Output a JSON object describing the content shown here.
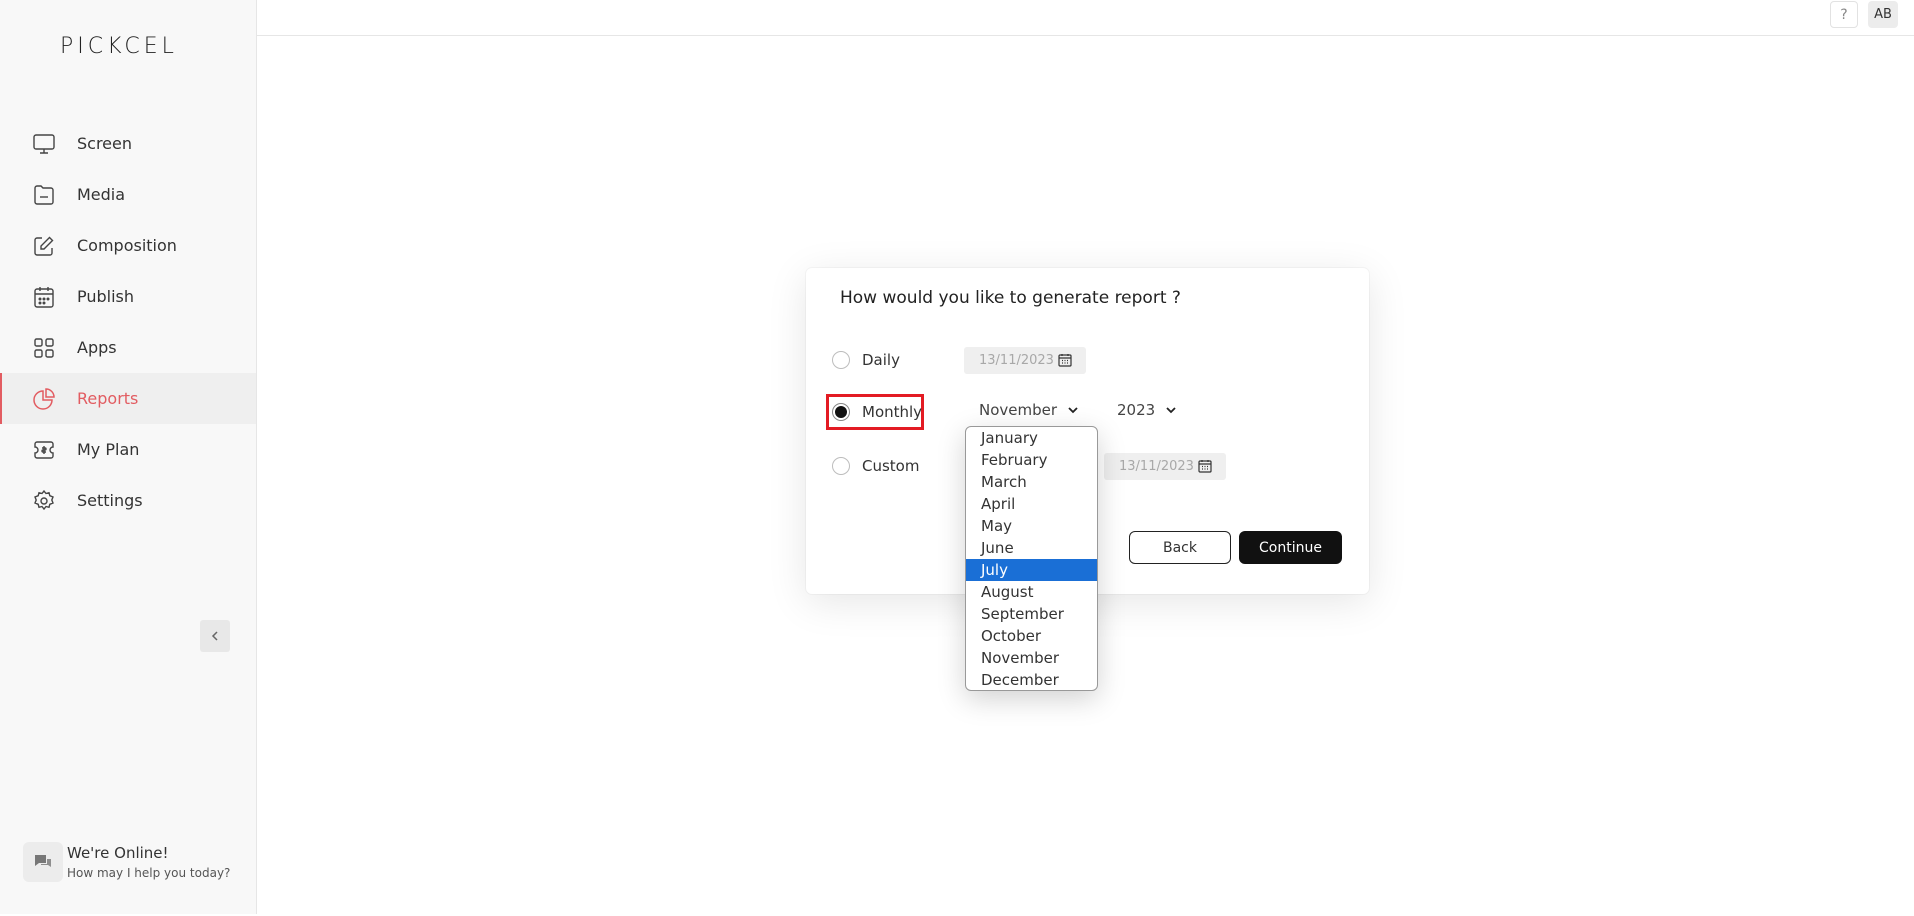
{
  "sidebar": {
    "logo": "PICKCEL",
    "items": [
      {
        "label": "Screen",
        "icon": "monitor-icon"
      },
      {
        "label": "Media",
        "icon": "folder-icon"
      },
      {
        "label": "Composition",
        "icon": "edit-icon"
      },
      {
        "label": "Publish",
        "icon": "calendar-icon"
      },
      {
        "label": "Apps",
        "icon": "grid-icon"
      },
      {
        "label": "Reports",
        "icon": "pie-chart-icon",
        "active": true
      },
      {
        "label": "My Plan",
        "icon": "ticket-icon"
      },
      {
        "label": "Settings",
        "icon": "gear-icon"
      }
    ],
    "accent_color": "#e25c61"
  },
  "chat": {
    "title": "We're Online!",
    "subtitle": "How may I help you today?"
  },
  "topbar": {
    "help_label": "?",
    "avatar_initials": "AB"
  },
  "dialog": {
    "title": "How would you like to generate report ?",
    "options": {
      "daily": {
        "label": "Daily",
        "date": "13/11/2023"
      },
      "monthly": {
        "label": "Monthly",
        "month": "November",
        "year": "2023",
        "checked": true
      },
      "custom": {
        "label": "Custom",
        "end_date": "13/11/2023"
      }
    },
    "back_label": "Back",
    "continue_label": "Continue"
  },
  "month_dropdown": {
    "options": [
      "January",
      "February",
      "March",
      "April",
      "May",
      "June",
      "July",
      "August",
      "September",
      "October",
      "November",
      "December"
    ],
    "highlighted": "July"
  }
}
